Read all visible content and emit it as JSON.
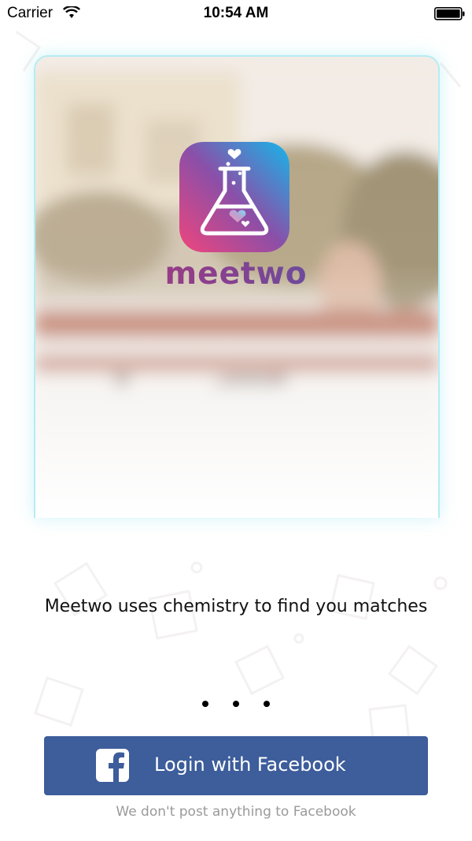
{
  "status_bar": {
    "carrier": "Carrier",
    "time": "10:54 AM"
  },
  "brand": {
    "name": "meetwo",
    "gradient_start": "#e24b7f",
    "gradient_end": "#1fb1e8"
  },
  "onboarding": {
    "tagline": "Meetwo uses chemistry to find you matches",
    "page_count": 3,
    "current_page": 1
  },
  "login": {
    "facebook_label": "Login with Facebook",
    "facebook_color": "#3d5d9b",
    "disclaimer": "We don't post anything to Facebook"
  },
  "icons": {
    "wifi": "wifi-icon",
    "battery": "battery-icon",
    "logo": "flask-heart-icon",
    "facebook": "facebook-icon"
  }
}
